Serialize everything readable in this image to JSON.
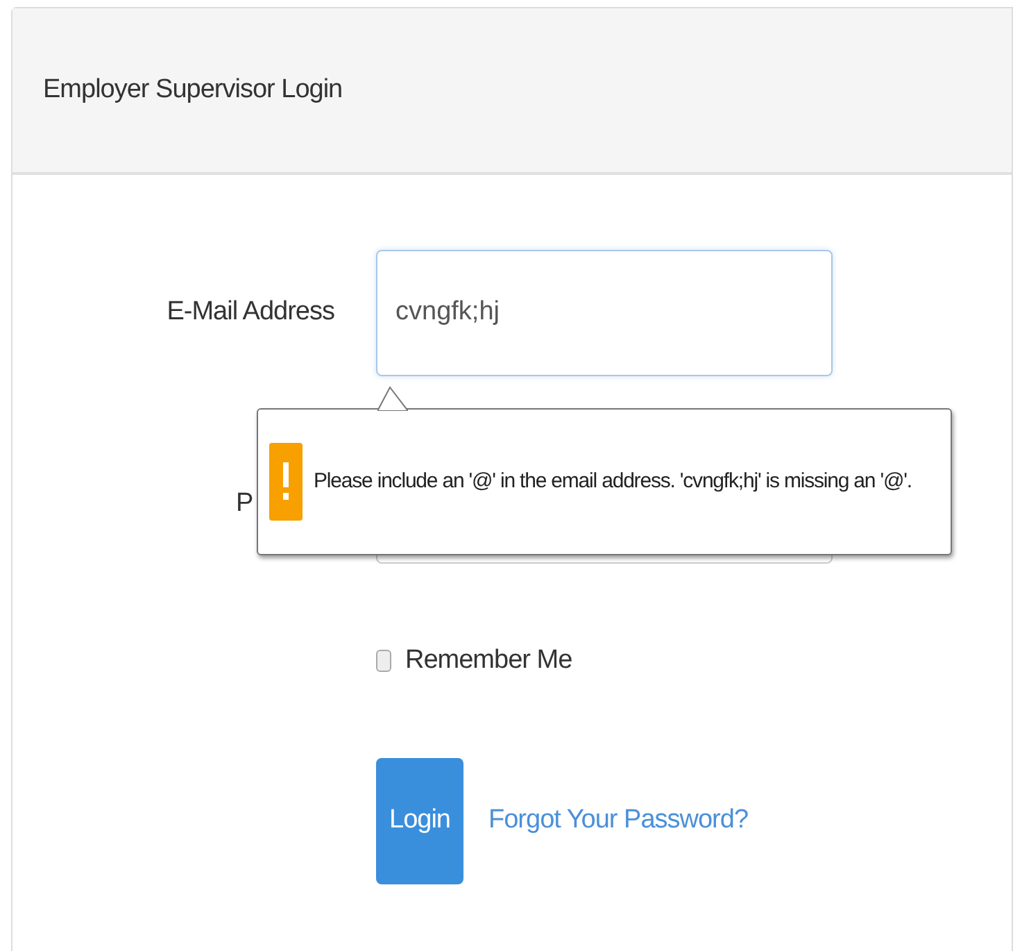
{
  "panel": {
    "title": "Employer Supervisor Login"
  },
  "email": {
    "label": "E-Mail Address",
    "value": "cvngfk;hj"
  },
  "password": {
    "label": "P"
  },
  "validation_tooltip": {
    "message": "Please include an '@' in the email address. 'cvngfk;hj' is missing an '@'."
  },
  "remember": {
    "label": "Remember Me",
    "checked": false
  },
  "login_button": "Login",
  "forgot_link": "Forgot Your Password?"
}
